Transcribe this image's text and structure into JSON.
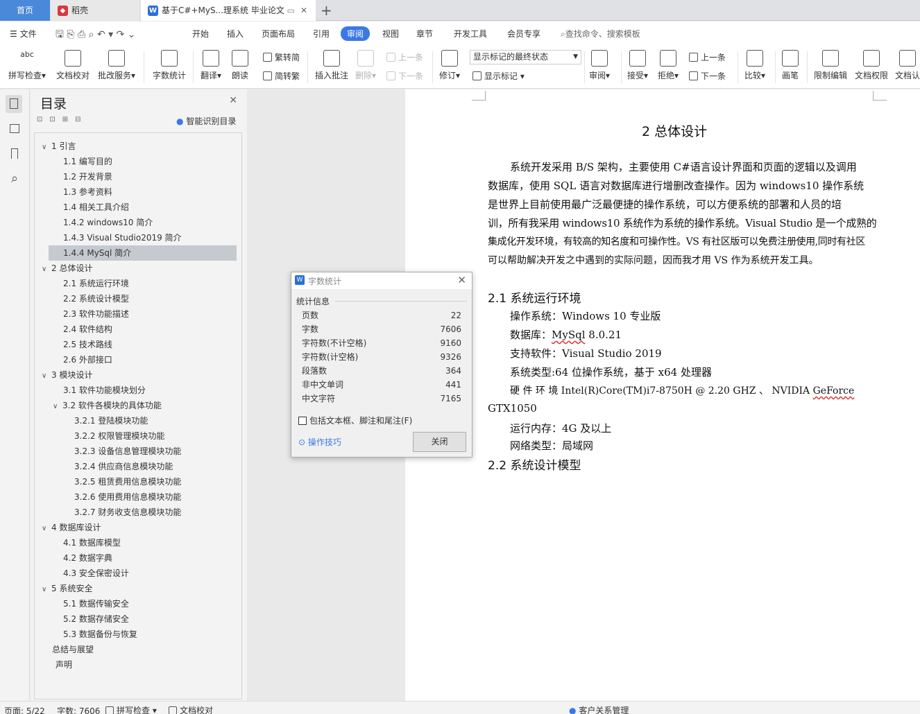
{
  "tabs": {
    "home": "首页",
    "daoke": "稻壳",
    "doc": "基于C#+MyS...理系统 毕业论文",
    "add": "+"
  },
  "menu": {
    "file": "文件",
    "items": [
      "开始",
      "插入",
      "页面布局",
      "引用",
      "审阅",
      "视图",
      "章节",
      "开发工具",
      "会员专享"
    ],
    "search": "查找命令、搜索模板"
  },
  "ribbon": {
    "spell": "拼写检查",
    "proof": "文档校对",
    "annotate_service": "批改服务",
    "wordcount": "字数统计",
    "translate": "翻译",
    "read": "朗读",
    "trad": "繁转简",
    "simp": "简转繁",
    "insert_comment": "插入批注",
    "delete": "删除",
    "prev_comment": "上一条",
    "next_comment": "下一条",
    "track": "修订",
    "markup_state": "显示标记的最终状态",
    "show_markup": "显示标记",
    "review": "审阅",
    "accept": "接受",
    "reject": "拒绝",
    "prev": "上一条",
    "next": "下一条",
    "compare": "比较",
    "pen": "画笔",
    "restrict": "限制编辑",
    "permission": "文档权限",
    "certify": "文档认"
  },
  "toc": {
    "title": "目录",
    "smart": "智能识别目录",
    "items": [
      {
        "t": "1  引言",
        "lvl": 0,
        "chev": "v"
      },
      {
        "t": "1.1  编写目的",
        "lvl": 1
      },
      {
        "t": "1.2  开发背景",
        "lvl": 1
      },
      {
        "t": "1.3  参考资料",
        "lvl": 1
      },
      {
        "t": "1.4  相关工具介绍",
        "lvl": 1
      },
      {
        "t": "1.4.2 windows10 简介",
        "lvl": 1
      },
      {
        "t": "1.4.3 Visual Studio2019 简介",
        "lvl": 1
      },
      {
        "t": "1.4.4 MySql 简介",
        "lvl": 1,
        "sel": true
      },
      {
        "t": "2  总体设计",
        "lvl": 0,
        "chev": "v"
      },
      {
        "t": "2.1  系统运行环境",
        "lvl": 1
      },
      {
        "t": "2.2  系统设计模型",
        "lvl": 1
      },
      {
        "t": "2.3  软件功能描述",
        "lvl": 1
      },
      {
        "t": "2.4  软件结构",
        "lvl": 1
      },
      {
        "t": "2.5  技术路线",
        "lvl": 1
      },
      {
        "t": "2.6  外部接口",
        "lvl": 1
      },
      {
        "t": "3  模块设计",
        "lvl": 0,
        "chev": "v"
      },
      {
        "t": "3.1  软件功能模块划分",
        "lvl": 1
      },
      {
        "t": "3.2  软件各模块的具体功能",
        "lvl": 1,
        "chev": "v"
      },
      {
        "t": "3.2.1 登陆模块功能",
        "lvl": 2
      },
      {
        "t": "3.2.2 权限管理模块功能",
        "lvl": 2
      },
      {
        "t": "3.2.3 设备信息管理模块功能",
        "lvl": 2
      },
      {
        "t": "3.2.4 供应商信息模块功能",
        "lvl": 2
      },
      {
        "t": "3.2.5 租赁费用信息模块功能",
        "lvl": 2
      },
      {
        "t": "3.2.6 使用费用信息模块功能",
        "lvl": 2
      },
      {
        "t": "3.2.7 财务收支信息模块功能",
        "lvl": 2
      },
      {
        "t": "4  数据库设计",
        "lvl": 0,
        "chev": "v"
      },
      {
        "t": "4.1  数据库模型",
        "lvl": 1
      },
      {
        "t": "4.2  数据字典",
        "lvl": 1
      },
      {
        "t": "4.3  安全保密设计",
        "lvl": 1
      },
      {
        "t": "5  系统安全",
        "lvl": 0,
        "chev": "v"
      },
      {
        "t": "5.1  数据传输安全",
        "lvl": 1
      },
      {
        "t": "5.2  数据存储安全",
        "lvl": 1
      },
      {
        "t": "5.3  数据备份与恢复",
        "lvl": 1
      },
      {
        "t": "总结与展望",
        "lvl": 0
      },
      {
        "t": "声明",
        "lvl": 0,
        "indent": true
      }
    ]
  },
  "doc": {
    "h1": "2  总体设计",
    "para1": [
      "系统开发采用 B/S 架构，主要使用 C#语言设计界面和页面的逻辑以及调用",
      "数据库，使用 SQL 语言对数据库进行增删改查操作。因为 windows10 操作系统",
      "是世界上目前使用最广泛最便捷的操作系统，可以方便系统的部署和人员的培",
      "训，所有我采用 windows10 系统作为系统的操作系统。Visual Studio 是一个成熟的",
      "集成化开发环境，有较高的知名度和可操作性。VS 有社区版可以免费注册使用,同时有社区",
      "可以帮助解决开发之中遇到的实际问题，因而我才用 VS 作为系统开发工具。"
    ],
    "h2_1": "2.1  系统运行环境",
    "env": {
      "os": "操作系统：Windows 10  专业版",
      "db_prefix": "数据库：",
      "db_name": "MySql",
      "db_ver": " 8.0.21",
      "sw": "支持软件：Visual Studio 2019",
      "type": "系统类型:64 位操作系统，基于 x64 处理器",
      "hw_line1": "硬 件 环 境  Intel(R)Core(TM)i7-8750H  @  2.20  GHZ 、 NVIDIA  ",
      "hw_geforce": "GeForce",
      "hw_line2": "GTX1050",
      "mem": "运行内存：4G 及以上",
      "net": "网络类型：局域网"
    },
    "h2_2": "2.2  系统设计模型"
  },
  "dialog": {
    "title": "字数统计",
    "section": "统计信息",
    "rows": [
      {
        "k": "页数",
        "v": "22"
      },
      {
        "k": "字数",
        "v": "7606"
      },
      {
        "k": "字符数(不计空格)",
        "v": "9160"
      },
      {
        "k": "字符数(计空格)",
        "v": "9326"
      },
      {
        "k": "段落数",
        "v": "364"
      },
      {
        "k": "非中文单词",
        "v": "441"
      },
      {
        "k": "中文字符",
        "v": "7165"
      }
    ],
    "include": "包括文本框、脚注和尾注(F)",
    "tips": "操作技巧",
    "close": "关闭"
  },
  "status": {
    "page": "页面: 5/22",
    "words": "字数: 7606",
    "spell": "拼写检查",
    "proof": "文档校对",
    "crm": "客户关系管理"
  },
  "colors": {
    "accent": "#3b78e7",
    "wps_red": "#d9363e",
    "selected": "#c5c9d0"
  }
}
